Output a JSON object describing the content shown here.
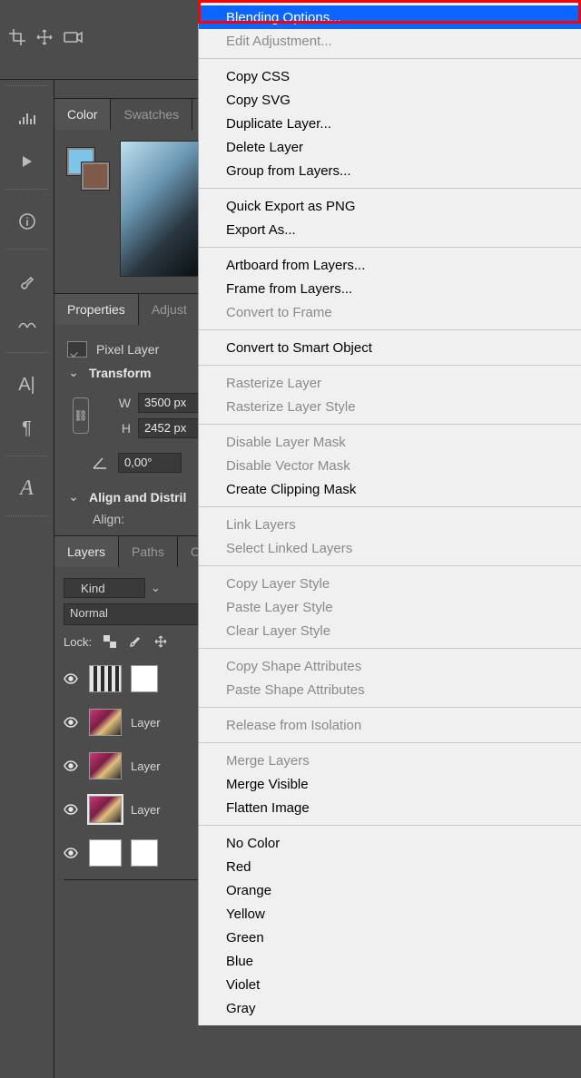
{
  "topbar": {
    "collapse_indicator": "‹‹"
  },
  "left_icons": {
    "info_tip": "Info",
    "brush_tip": "Brush Settings",
    "clone_tip": "Clone Source",
    "char_label": "A|",
    "para_label": "¶",
    "glyph_label": "A"
  },
  "color_panel": {
    "tabs": {
      "color": "Color",
      "swatches": "Swatches"
    },
    "fg": "#7cc4e8",
    "bg": "#7f5a4a"
  },
  "properties_panel": {
    "tabs": {
      "properties": "Properties",
      "adjust": "Adjust"
    },
    "layer_type": "Pixel Layer",
    "sections": {
      "transform": "Transform",
      "align": "Align and Distril"
    },
    "w_label": "W",
    "w_value": "3500 px",
    "h_label": "H",
    "h_value": "2452 px",
    "angle_label": "⊿",
    "angle_value": "0,00°",
    "align_label": "Align:"
  },
  "layers_panel": {
    "tabs": {
      "layers": "Layers",
      "paths": "Paths",
      "chan": "C"
    },
    "kind_label": "Kind",
    "blend_mode": "Normal",
    "lock_label": "Lock:",
    "rows": [
      {
        "name": "",
        "kind": "ruler"
      },
      {
        "name": "Layer",
        "kind": "photo"
      },
      {
        "name": "Layer",
        "kind": "photo"
      },
      {
        "name": "Layer",
        "kind": "photo",
        "selected": true
      },
      {
        "name": "",
        "kind": "white",
        "mask": true
      }
    ]
  },
  "context_menu": {
    "groups": [
      [
        {
          "label": "Blending Options...",
          "enabled": true,
          "selected": true
        },
        {
          "label": "Edit Adjustment...",
          "enabled": false
        }
      ],
      [
        {
          "label": "Copy CSS",
          "enabled": true
        },
        {
          "label": "Copy SVG",
          "enabled": true
        },
        {
          "label": "Duplicate Layer...",
          "enabled": true
        },
        {
          "label": "Delete Layer",
          "enabled": true
        },
        {
          "label": "Group from Layers...",
          "enabled": true
        }
      ],
      [
        {
          "label": "Quick Export as PNG",
          "enabled": true
        },
        {
          "label": "Export As...",
          "enabled": true
        }
      ],
      [
        {
          "label": "Artboard from Layers...",
          "enabled": true
        },
        {
          "label": "Frame from Layers...",
          "enabled": true
        },
        {
          "label": "Convert to Frame",
          "enabled": false
        }
      ],
      [
        {
          "label": "Convert to Smart Object",
          "enabled": true
        }
      ],
      [
        {
          "label": "Rasterize Layer",
          "enabled": false
        },
        {
          "label": "Rasterize Layer Style",
          "enabled": false
        }
      ],
      [
        {
          "label": "Disable Layer Mask",
          "enabled": false
        },
        {
          "label": "Disable Vector Mask",
          "enabled": false
        },
        {
          "label": "Create Clipping Mask",
          "enabled": true
        }
      ],
      [
        {
          "label": "Link Layers",
          "enabled": false
        },
        {
          "label": "Select Linked Layers",
          "enabled": false
        }
      ],
      [
        {
          "label": "Copy Layer Style",
          "enabled": false
        },
        {
          "label": "Paste Layer Style",
          "enabled": false
        },
        {
          "label": "Clear Layer Style",
          "enabled": false
        }
      ],
      [
        {
          "label": "Copy Shape Attributes",
          "enabled": false
        },
        {
          "label": "Paste Shape Attributes",
          "enabled": false
        }
      ],
      [
        {
          "label": "Release from Isolation",
          "enabled": false
        }
      ],
      [
        {
          "label": "Merge Layers",
          "enabled": false
        },
        {
          "label": "Merge Visible",
          "enabled": true
        },
        {
          "label": "Flatten Image",
          "enabled": true
        }
      ],
      [
        {
          "label": "No Color",
          "enabled": true
        },
        {
          "label": "Red",
          "enabled": true
        },
        {
          "label": "Orange",
          "enabled": true
        },
        {
          "label": "Yellow",
          "enabled": true
        },
        {
          "label": "Green",
          "enabled": true
        },
        {
          "label": "Blue",
          "enabled": true
        },
        {
          "label": "Violet",
          "enabled": true
        },
        {
          "label": "Gray",
          "enabled": true
        }
      ]
    ]
  }
}
